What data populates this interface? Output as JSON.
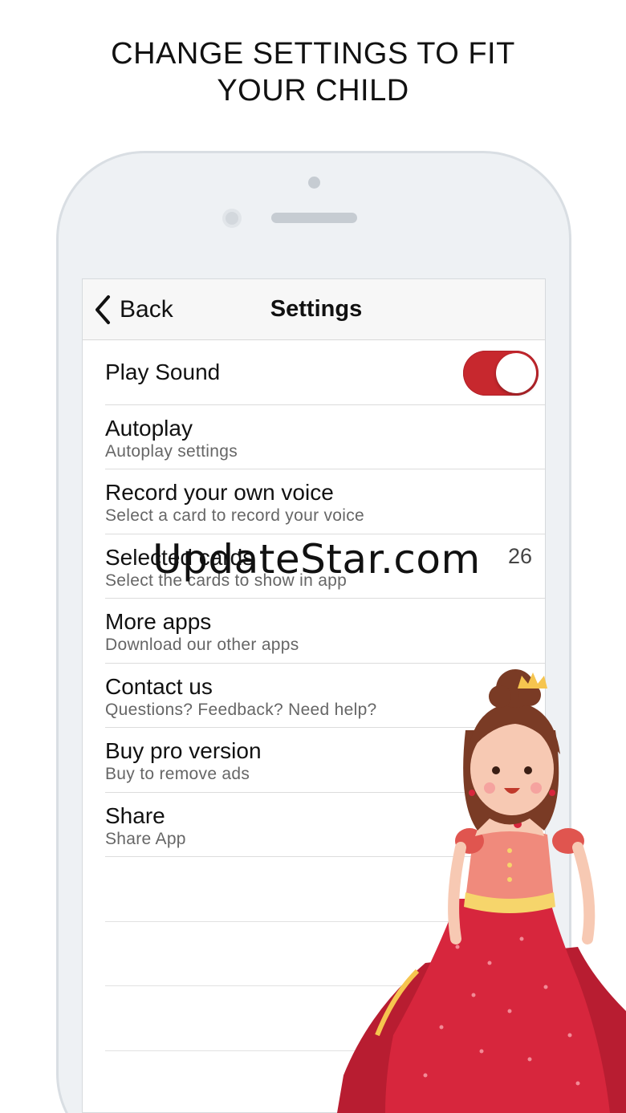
{
  "promo": {
    "line1": "CHANGE SETTINGS TO FIT",
    "line2": "YOUR CHILD"
  },
  "navbar": {
    "back_label": "Back",
    "title": "Settings"
  },
  "settings": {
    "play_sound": {
      "title": "Play Sound",
      "toggle_on": true
    },
    "autoplay": {
      "title": "Autoplay",
      "subtitle": "Autoplay settings"
    },
    "record_voice": {
      "title": "Record your own voice",
      "subtitle": "Select a card to record your voice"
    },
    "selected_cards": {
      "title": "Selected cards",
      "subtitle": "Select the cards to show in app",
      "value": "26"
    },
    "more_apps": {
      "title": "More apps",
      "subtitle": "Download our other apps"
    },
    "contact_us": {
      "title": "Contact us",
      "subtitle": "Questions? Feedback? Need help?"
    },
    "buy_pro": {
      "title": "Buy pro version",
      "subtitle": "Buy to remove ads"
    },
    "share": {
      "title": "Share",
      "subtitle": "Share App"
    }
  },
  "watermark": "UpdateStar.com",
  "colors": {
    "toggle_on": "#c7282e",
    "dress": "#d7263d",
    "hair": "#7a3b25"
  }
}
